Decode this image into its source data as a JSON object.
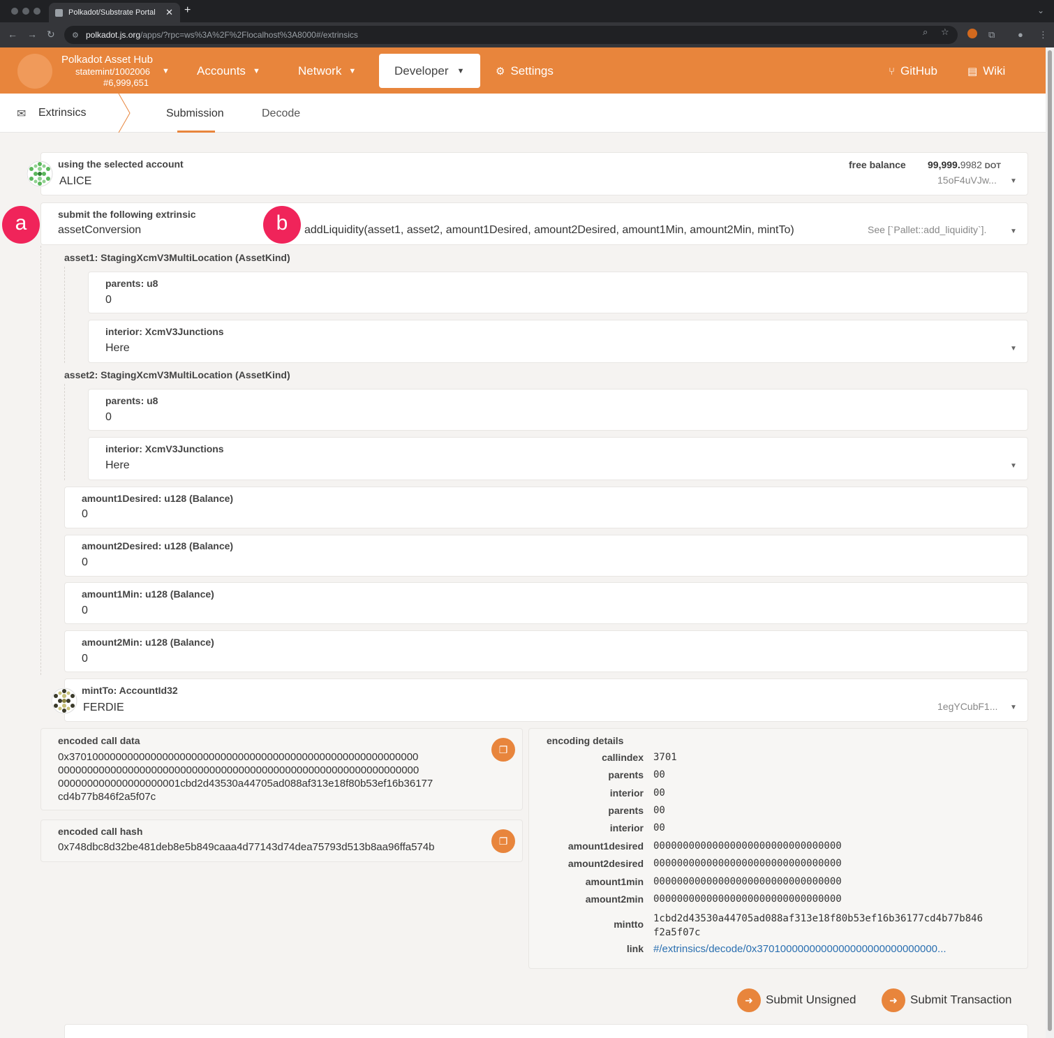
{
  "browser": {
    "tab_title": "Polkadot/Substrate Portal",
    "close": "✕",
    "new_tab": "+",
    "url_host": "polkadot.js.org",
    "url_rest": "/apps/?rpc=ws%3A%2F%2Flocalhost%3A8000#/extrinsics"
  },
  "header": {
    "chain_name": "Polkadot Asset Hub",
    "chain_version": "statemint/1002006",
    "block_number": "#6,999,651",
    "menu": {
      "accounts": "Accounts",
      "network": "Network",
      "developer": "Developer",
      "settings": "Settings",
      "github": "GitHub",
      "wiki": "Wiki"
    }
  },
  "subnav": {
    "title": "Extrinsics",
    "tabs": [
      "Submission",
      "Decode"
    ]
  },
  "account": {
    "label": "using the selected account",
    "name": "ALICE",
    "free_balance_label": "free balance",
    "balance_int": "99,999.",
    "balance_dec": "9982",
    "balance_unit": "DOT",
    "address": "15oF4uVJw..."
  },
  "extrinsic": {
    "label": "submit the following extrinsic",
    "pallet": "assetConversion",
    "call": "addLiquidity(asset1, asset2, amount1Desired, amount2Desired, amount1Min, amount2Min, mintTo)",
    "doc": "See [`Pallet::add_liquidity`]."
  },
  "badges": {
    "a": "a",
    "b": "b"
  },
  "params": {
    "asset1": {
      "label": "asset1: StagingXcmV3MultiLocation (AssetKind)",
      "parents_label": "parents: u8",
      "parents_value": "0",
      "interior_label": "interior: XcmV3Junctions",
      "interior_value": "Here"
    },
    "asset2": {
      "label": "asset2: StagingXcmV3MultiLocation (AssetKind)",
      "parents_label": "parents: u8",
      "parents_value": "0",
      "interior_label": "interior: XcmV3Junctions",
      "interior_value": "Here"
    },
    "amount1Desired": {
      "label": "amount1Desired: u128 (Balance)",
      "value": "0"
    },
    "amount2Desired": {
      "label": "amount2Desired: u128 (Balance)",
      "value": "0"
    },
    "amount1Min": {
      "label": "amount1Min: u128 (Balance)",
      "value": "0"
    },
    "amount2Min": {
      "label": "amount2Min: u128 (Balance)",
      "value": "0"
    },
    "mintTo": {
      "label": "mintTo: AccountId32",
      "name": "FERDIE",
      "address": "1egYCubF1..."
    }
  },
  "encoded": {
    "call_data_label": "encoded call data",
    "call_data_lines": [
      "0x370100000000000000000000000000000000000000000000000000000000",
      "00000000000000000000000000000000000000000000000000000000000000",
      "000000000000000000001cbd2d43530a44705ad088af313e18f80b53ef16b36177",
      "cd4b77b846f2a5f07c"
    ],
    "call_hash_label": "encoded call hash",
    "call_hash": "0x748dbc8d32be481deb8e5b849caaa4d77143d74dea75793d513b8aa96ffa574b"
  },
  "encoding_details": {
    "label": "encoding details",
    "rows": [
      {
        "key": "callindex",
        "value": "3701"
      },
      {
        "key": "parents",
        "value": "00"
      },
      {
        "key": "interior",
        "value": "00"
      },
      {
        "key": "parents",
        "value": "00"
      },
      {
        "key": "interior",
        "value": "00"
      },
      {
        "key": "amount1desired",
        "value": "00000000000000000000000000000000"
      },
      {
        "key": "amount2desired",
        "value": "00000000000000000000000000000000"
      },
      {
        "key": "amount1min",
        "value": "00000000000000000000000000000000"
      },
      {
        "key": "amount2min",
        "value": "00000000000000000000000000000000"
      }
    ],
    "mintto_key": "mintto",
    "mintto_line1": "1cbd2d43530a44705ad088af313e18f80b53ef16b36177cd4b77b846",
    "mintto_line2": "f2a5f07c",
    "link_key": "link",
    "link_value": "#/extrinsics/decode/0x3701000000000000000000000000000..."
  },
  "actions": {
    "submit_unsigned": "Submit Unsigned",
    "submit_transaction": "Submit Transaction"
  },
  "colors": {
    "brand": "#e8853c",
    "badge": "#f0245a",
    "link": "#2a6fb0"
  }
}
